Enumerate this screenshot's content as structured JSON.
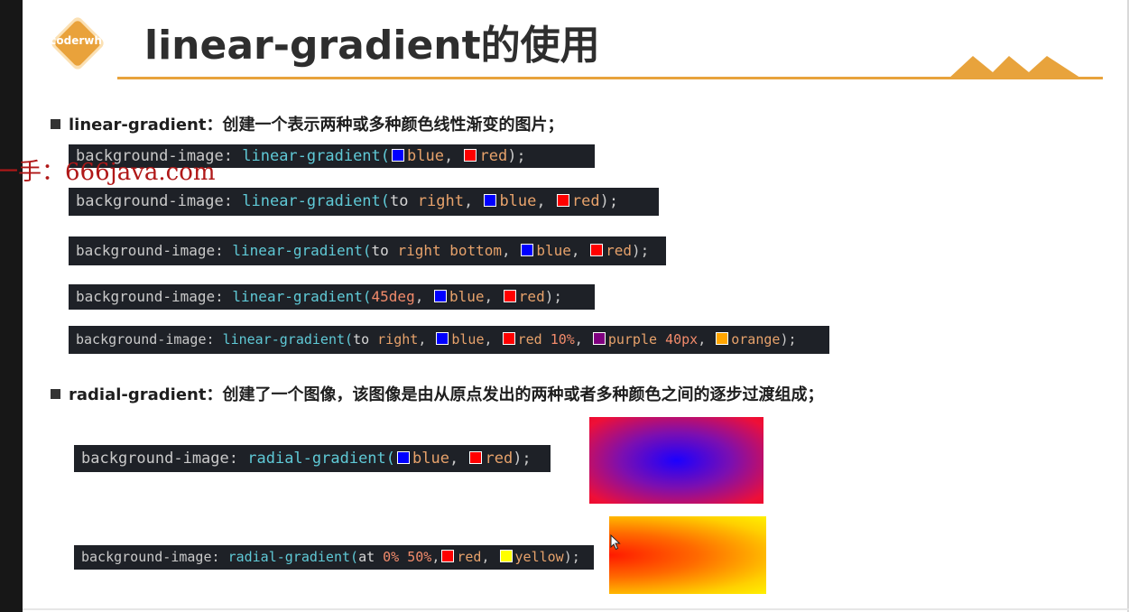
{
  "logo": {
    "text": "coderwhy"
  },
  "title": "linear-gradient的使用",
  "sections": {
    "linear": {
      "label": "linear-gradient：创建一个表示两种或多种颜色线性渐变的图片；"
    },
    "radial": {
      "label": "radial-gradient：创建了一个图像，该图像是由从原点发出的两种或者多种颜色之间的逐步过渡组成；"
    }
  },
  "watermark": "一手：666java.com",
  "code": {
    "prop": "background-image:",
    "linear_fn": "linear-gradient(",
    "radial_fn": "radial-gradient(",
    "close": ");",
    "comma": ",",
    "to": "to",
    "at": "at",
    "right": "right",
    "bottom": "bottom",
    "deg": "45deg",
    "blue": "blue",
    "red": "red",
    "purple": "purple",
    "orange": "orange",
    "yellow": "yellow",
    "pct10": "10%",
    "px40": "40px",
    "pct0": "0%",
    "pct50": "50%"
  },
  "colors": {
    "blue": "#0000ff",
    "red": "#ff0000",
    "purple": "#800080",
    "orange": "#ffa500",
    "yellow": "#ffff00",
    "accent": "#e8a33c"
  }
}
